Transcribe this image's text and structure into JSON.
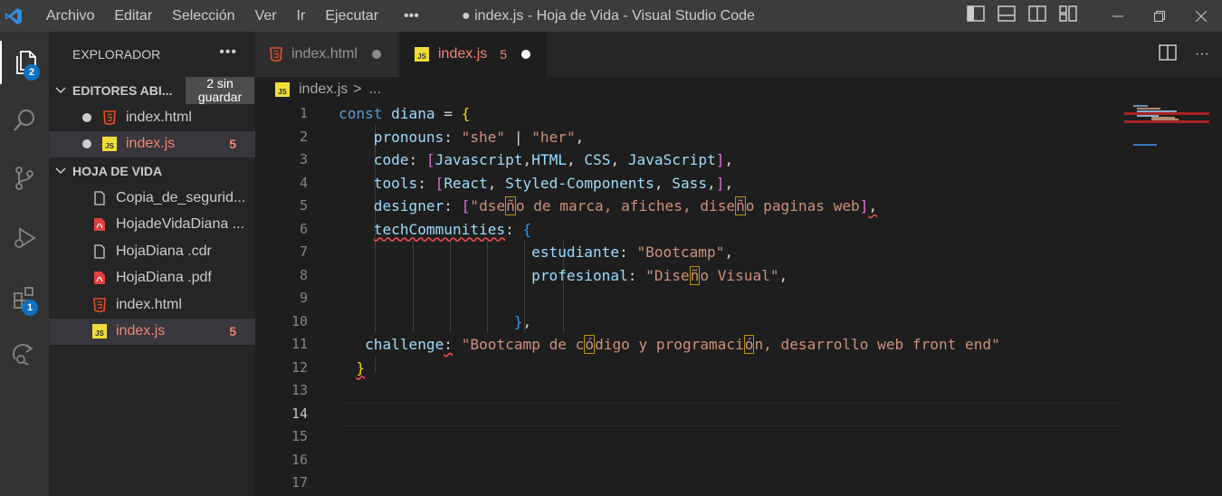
{
  "titlebar": {
    "menu": [
      "Archivo",
      "Editar",
      "Selección",
      "Ver",
      "Ir",
      "Ejecutar",
      "•••"
    ],
    "window_title": "● index.js - Hoja de Vida - Visual Studio Code"
  },
  "activity": {
    "explorer_badge": "2",
    "extensions_badge": "1"
  },
  "sidebar": {
    "title": "EXPLORADOR",
    "more": "•••",
    "open_editors": {
      "label": "EDITORES ABI...",
      "dirty_label": "2 sin guardar",
      "files": [
        {
          "name": "index.html",
          "type": "html",
          "count": ""
        },
        {
          "name": "index.js",
          "type": "js",
          "count": "5"
        }
      ]
    },
    "folder": {
      "label": "HOJA DE VIDA",
      "files": [
        {
          "name": "Copia_de_segurid...",
          "type": "file",
          "count": ""
        },
        {
          "name": "HojadeVidaDiana ...",
          "type": "pdf",
          "count": ""
        },
        {
          "name": "HojaDiana .cdr",
          "type": "file",
          "count": ""
        },
        {
          "name": "HojaDiana .pdf",
          "type": "pdf",
          "count": ""
        },
        {
          "name": "index.html",
          "type": "html",
          "count": ""
        },
        {
          "name": "index.js",
          "type": "js",
          "count": "5"
        }
      ]
    }
  },
  "tabs": [
    {
      "label": "index.html",
      "type": "html",
      "count": "",
      "active": false
    },
    {
      "label": "index.js",
      "type": "js",
      "count": "5",
      "active": true
    }
  ],
  "breadcrumb": {
    "file": "index.js",
    "separator": ">",
    "rest": "..."
  },
  "editor": {
    "current_line": 14,
    "line_numbers": [
      "1",
      "2",
      "3",
      "4",
      "5",
      "6",
      "7",
      "8",
      "9",
      "10",
      "11",
      "12",
      "13",
      "14",
      "15",
      "16",
      "17"
    ],
    "lines": [
      [
        {
          "t": "const ",
          "c": "k"
        },
        {
          "t": "diana",
          "c": "v"
        },
        {
          "t": " = ",
          "c": "p"
        },
        {
          "t": "{",
          "c": "b1"
        }
      ],
      [
        {
          "t": "    "
        },
        {
          "t": "pronouns",
          "c": "v"
        },
        {
          "t": ": ",
          "c": "p"
        },
        {
          "t": "\"she\"",
          "c": "s"
        },
        {
          "t": " | ",
          "c": "p"
        },
        {
          "t": "\"her\"",
          "c": "s"
        },
        {
          "t": ",",
          "c": "p"
        }
      ],
      [
        {
          "t": "    "
        },
        {
          "t": "code",
          "c": "v"
        },
        {
          "t": ": ",
          "c": "p"
        },
        {
          "t": "[",
          "c": "b2"
        },
        {
          "t": "Javascript",
          "c": "v"
        },
        {
          "t": ",",
          "c": "p"
        },
        {
          "t": "HTML",
          "c": "v"
        },
        {
          "t": ", ",
          "c": "p"
        },
        {
          "t": "CSS",
          "c": "v"
        },
        {
          "t": ", ",
          "c": "p"
        },
        {
          "t": "JavaScript",
          "c": "v"
        },
        {
          "t": "]",
          "c": "b2"
        },
        {
          "t": ",",
          "c": "p"
        }
      ],
      [
        {
          "t": "    "
        },
        {
          "t": "tools",
          "c": "v"
        },
        {
          "t": ": ",
          "c": "p"
        },
        {
          "t": "[",
          "c": "b2"
        },
        {
          "t": "React",
          "c": "v"
        },
        {
          "t": ", ",
          "c": "p"
        },
        {
          "t": "Styled-Components",
          "c": "v"
        },
        {
          "t": ", ",
          "c": "p"
        },
        {
          "t": "Sass",
          "c": "v"
        },
        {
          "t": ",",
          "c": "p"
        },
        {
          "t": "]",
          "c": "b2"
        },
        {
          "t": ",",
          "c": "p"
        }
      ],
      [
        {
          "t": "    "
        },
        {
          "t": "designer",
          "c": "v"
        },
        {
          "t": ": ",
          "c": "p"
        },
        {
          "t": "[",
          "c": "b2"
        },
        {
          "t": "\"dse",
          "c": "s"
        },
        {
          "t": "ñ",
          "c": "s",
          "box": true
        },
        {
          "t": "o de marca, afiches, dise",
          "c": "s"
        },
        {
          "t": "ñ",
          "c": "s",
          "box": true
        },
        {
          "t": "o paginas web",
          "c": "s"
        },
        {
          "t": "]",
          "c": "b2"
        },
        {
          "t": ",",
          "c": "p",
          "squig": true
        }
      ],
      [
        {
          "t": "    "
        },
        {
          "t": "techCommunities",
          "c": "v",
          "squig": true
        },
        {
          "t": ": ",
          "c": "p"
        },
        {
          "t": "{",
          "c": "b3"
        }
      ],
      [
        {
          "t": "                      "
        },
        {
          "t": "estudiante",
          "c": "v"
        },
        {
          "t": ": ",
          "c": "p"
        },
        {
          "t": "\"Bootcamp\"",
          "c": "s"
        },
        {
          "t": ",",
          "c": "p"
        }
      ],
      [
        {
          "t": "                      "
        },
        {
          "t": "profesional",
          "c": "v"
        },
        {
          "t": ": ",
          "c": "p"
        },
        {
          "t": "\"Dise",
          "c": "s"
        },
        {
          "t": "ñ",
          "c": "s",
          "box": true
        },
        {
          "t": "o Visual\"",
          "c": "s"
        },
        {
          "t": ",",
          "c": "p"
        }
      ],
      [
        {
          "t": ""
        }
      ],
      [
        {
          "t": "                    "
        },
        {
          "t": "}",
          "c": "b3"
        },
        {
          "t": ",",
          "c": "p"
        }
      ],
      [
        {
          "t": "   "
        },
        {
          "t": "challenge",
          "c": "v"
        },
        {
          "t": ":",
          "c": "p",
          "squig": true
        },
        {
          "t": " "
        },
        {
          "t": "\"Bootcamp de c",
          "c": "s"
        },
        {
          "t": "ó",
          "c": "s",
          "box": true
        },
        {
          "t": "digo y programaci",
          "c": "s"
        },
        {
          "t": "ó",
          "c": "s",
          "box": true
        },
        {
          "t": "n, desarrollo web front end\"",
          "c": "s"
        }
      ],
      [
        {
          "t": "  "
        },
        {
          "t": "}",
          "c": "b1",
          "squig": true
        }
      ],
      [
        {
          "t": ""
        }
      ],
      [
        {
          "t": ""
        }
      ],
      [
        {
          "t": ""
        }
      ],
      [
        {
          "t": ""
        }
      ],
      [
        {
          "t": ""
        }
      ]
    ]
  },
  "colors": {
    "accent": "#007acc",
    "error": "#f48771",
    "badge": "#0e70c0"
  }
}
